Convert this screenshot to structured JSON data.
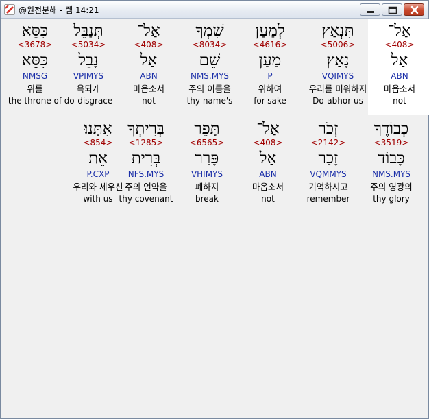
{
  "window": {
    "title": "@원전분해 - 렘 14:21",
    "minimize_icon": "minimize-icon",
    "maximize_icon": "maximize-icon",
    "close_icon": "close-icon"
  },
  "rows": [
    [
      {
        "surface": "אַל־",
        "strong": "<408>",
        "lemma": "אַל",
        "morph": "ABN",
        "kor": "마옵소서",
        "eng": "not",
        "highlight": true
      },
      {
        "surface": "תִּנְאַץ",
        "strong": "<5006>",
        "lemma": "נָאַץ",
        "morph": "VQIMYS",
        "kor": "우리를 미워하지",
        "eng": "Do-abhor us"
      },
      {
        "surface": "לְמַעַן",
        "strong": "<4616>",
        "lemma": "מַעַן",
        "morph": "P",
        "kor": "위하여",
        "eng": "for-sake"
      },
      {
        "surface": "שִׁמְךָ",
        "strong": "<8034>",
        "lemma": "שֵׁם",
        "morph": "NMS.MYS",
        "kor": "주의 이름을",
        "eng": "thy name's"
      },
      {
        "surface": "אַל־",
        "strong": "<408>",
        "lemma": "אַל",
        "morph": "ABN",
        "kor": "마옵소서",
        "eng": "not"
      },
      {
        "surface": "תְּנַבֵּל",
        "strong": "<5034>",
        "lemma": "נָבֵל",
        "morph": "VPIMYS",
        "kor": "욕되게",
        "eng": "do-disgrace"
      },
      {
        "surface": "כִּסֵּא",
        "strong": "<3678>",
        "lemma": "כִּסֵּא",
        "morph": "NMSG",
        "kor": "위를",
        "eng": "the throne of"
      }
    ],
    [
      {
        "surface": "כְבוֹדֶךָ",
        "strong": "<3519>",
        "lemma": "כָּבוֹד",
        "morph": "NMS.MYS",
        "kor": "주의 영광의",
        "eng": "thy glory"
      },
      {
        "surface": "זְכֹר",
        "strong": "<2142>",
        "lemma": "זָכַר",
        "morph": "VQMMYS",
        "kor": "기억하시고",
        "eng": "remember"
      },
      {
        "surface": "אַל־",
        "strong": "<408>",
        "lemma": "אַל",
        "morph": "ABN",
        "kor": "마옵소서",
        "eng": "not"
      },
      {
        "surface": "תָּפֵר",
        "strong": "<6565>",
        "lemma": "פָּרַר",
        "morph": "VHIMYS",
        "kor": "폐하지",
        "eng": "break"
      },
      {
        "surface": "בְּרִיתְךָ",
        "strong": "<1285>",
        "lemma": "בְּרִית",
        "morph": "NFS.MYS",
        "kor": "주의 언약을",
        "eng": "thy covenant"
      },
      {
        "surface": "אִתָּנוּ׃",
        "strong": "<854>",
        "lemma": "אֵת",
        "morph": "P.CXP",
        "kor": "우리와 세우신",
        "eng": "with us"
      }
    ]
  ]
}
